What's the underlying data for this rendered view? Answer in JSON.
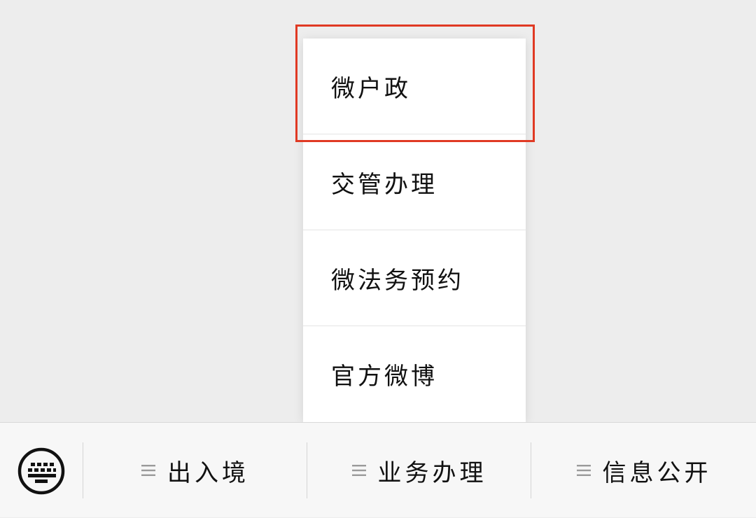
{
  "popup_menu": {
    "items": [
      {
        "label": "微户政"
      },
      {
        "label": "交管办理"
      },
      {
        "label": "微法务预约"
      },
      {
        "label": "官方微博"
      }
    ]
  },
  "bottom_menu": {
    "keyboard_icon": "keyboard-icon",
    "tabs": [
      {
        "label": "出入境",
        "icon": "menu-list-icon"
      },
      {
        "label": "业务办理",
        "icon": "menu-list-icon"
      },
      {
        "label": "信息公开",
        "icon": "menu-list-icon"
      }
    ]
  },
  "colors": {
    "highlight": "#e03a24",
    "background": "#ededed",
    "bar": "#f7f7f7"
  }
}
